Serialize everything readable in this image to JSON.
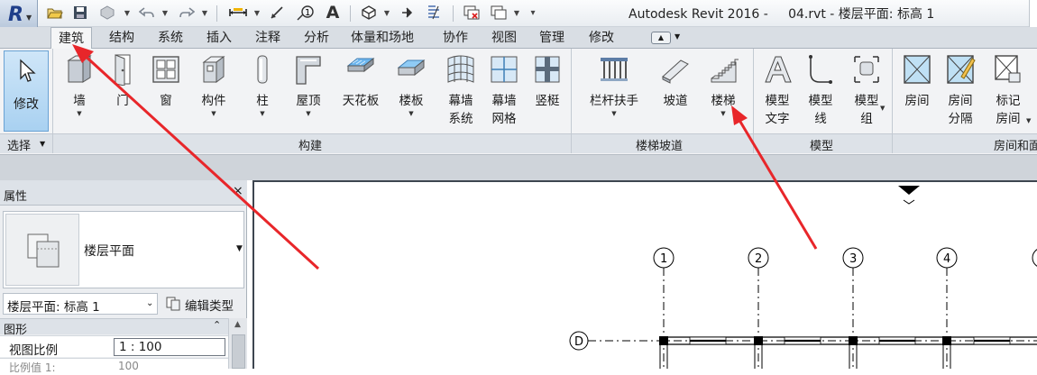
{
  "window": {
    "title": "Autodesk Revit 2016 -     04.rvt - 楼层平面: 标高 1",
    "app_letter": "R"
  },
  "tabs": [
    {
      "label": "建筑",
      "active": true
    },
    {
      "label": "结构"
    },
    {
      "label": "系统"
    },
    {
      "label": "插入"
    },
    {
      "label": "注释"
    },
    {
      "label": "分析"
    },
    {
      "label": "体量和场地"
    },
    {
      "label": "协作"
    },
    {
      "label": "视图"
    },
    {
      "label": "管理"
    },
    {
      "label": "修改"
    }
  ],
  "ribbon": {
    "modify_label": "修改",
    "select_panel": "选择",
    "build_panel": "构建",
    "stairs_panel": "楼梯坡道",
    "model_panel": "模型",
    "room_panel": "房间和面",
    "tools": {
      "wall": "墙",
      "door": "门",
      "window": "窗",
      "component": "构件",
      "column": "柱",
      "roof": "屋顶",
      "ceiling": "天花板",
      "floor": "楼板",
      "curtain_system_1": "幕墙",
      "curtain_system_2": "系统",
      "curtain_grid_1": "幕墙",
      "curtain_grid_2": "网格",
      "mullion": "竖梃",
      "railing": "栏杆扶手",
      "ramp": "坡道",
      "stair": "楼梯",
      "model_text_1": "模型",
      "model_text_2": "文字",
      "model_line_1": "模型",
      "model_line_2": "线",
      "model_group_1": "模型",
      "model_group_2": "组",
      "room": "房间",
      "room_sep_1": "房间",
      "room_sep_2": "分隔",
      "tag_room_1": "标记",
      "tag_room_2": "房间"
    }
  },
  "properties": {
    "title": "属性",
    "close": "×",
    "type_name": "楼层平面",
    "instance": "楼层平面: 标高 1",
    "edit_type": "编辑类型",
    "section": "图形",
    "rows": [
      {
        "key": "视图比例",
        "value": "1 : 100"
      },
      {
        "key": "比例值 1:",
        "value": "100"
      }
    ]
  },
  "drawing": {
    "grid_numbers": [
      "1",
      "2",
      "3",
      "4"
    ],
    "grid_letter": "D"
  },
  "colors": {
    "annotation_arrow": "#e8262a",
    "ribbon_bg": "#f2f3f5",
    "selected_tool": "#a9d1f1"
  }
}
